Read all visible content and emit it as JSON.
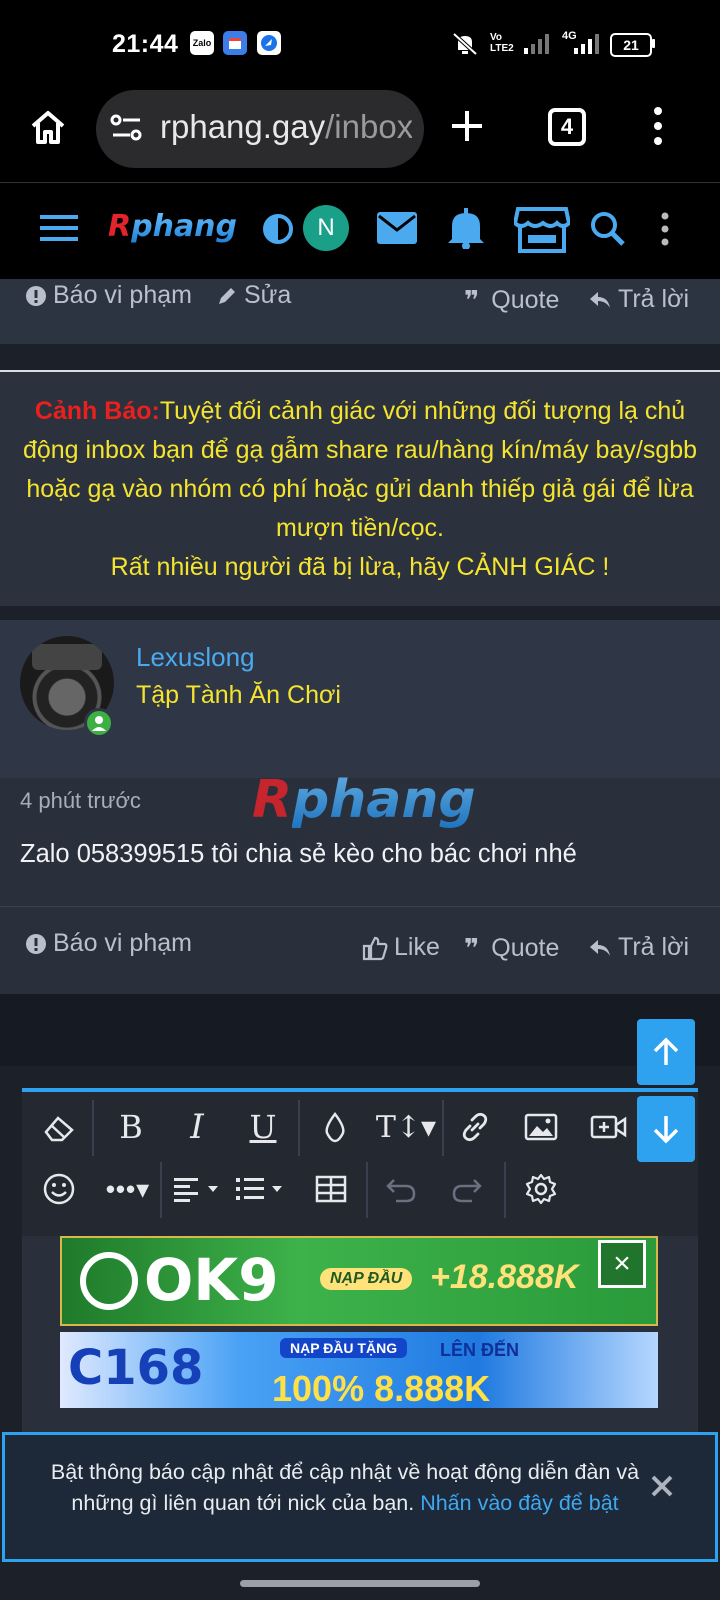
{
  "status_bar": {
    "time": "21:44",
    "notification_icons": [
      "zalo-icon",
      "calendar-icon",
      "browser-icon"
    ],
    "zalo_label": "Zalo",
    "volte_label": "Vo LTE2",
    "network_label": "4G",
    "battery": "21"
  },
  "browser": {
    "url_main": "rphang.gay",
    "url_rest": "/inbox",
    "tab_count": "4"
  },
  "forum_nav": {
    "logo_r": "R",
    "logo_rest": "phang",
    "avatar_letter": "N"
  },
  "post_top_actions": {
    "report": "Báo vi phạm",
    "edit": "Sửa",
    "quote": "Quote",
    "reply": "Trả lời"
  },
  "warning": {
    "label": "Cảnh Báo:",
    "text": "Tuyệt đối cảnh giác với những đối tượng lạ chủ động inbox bạn để gạ gẫm share rau/hàng kín/máy bay/sgbb hoặc gạ vào nhóm có phí hoặc gửi danh thiếp giả gái để lừa mượn tiền/cọc.",
    "line2": "Rất nhiều người đã bị lừa, hãy CẢNH GIÁC !"
  },
  "post": {
    "username": "Lexuslong",
    "user_title": "Tập Tành Ăn Chơi",
    "time": "4 phút trước",
    "content": "Zalo 058399515 tôi chia sẻ kèo cho bác chơi nhé",
    "watermark_r": "R",
    "watermark_rest": "phang",
    "actions": {
      "report": "Báo vi phạm",
      "like": "Like",
      "quote": "Quote",
      "reply": "Trả lời"
    }
  },
  "ads": [
    {
      "brand": "OK9",
      "badge": "NẠP ĐẦU",
      "bonus": "+18.888K"
    },
    {
      "brand": "C168",
      "badge": "NẠP ĐẦU TẶNG",
      "bonus_label": "LÊN ĐẾN",
      "bonus": "100% 8.888K"
    }
  ],
  "notify": {
    "text": "Bật thông báo cập nhật để cập nhật về hoạt động diễn đàn và những gì liên quan tới nick của bạn.",
    "link": "Nhấn vào đây để bật"
  },
  "colors": {
    "accent": "#2ea2ef",
    "warning_text": "#f4e430",
    "warning_label": "#e8201e",
    "username": "#4aa9ef",
    "online": "#3cb043"
  }
}
